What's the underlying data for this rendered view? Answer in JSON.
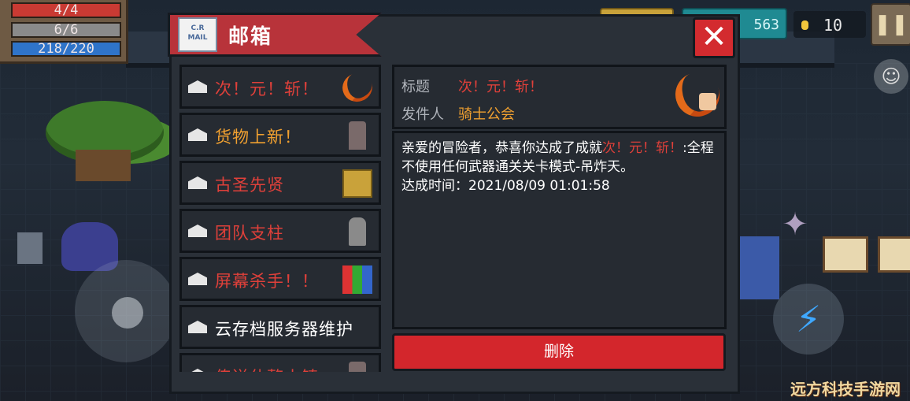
{
  "hud": {
    "hp": "4/4",
    "armor": "6/6",
    "energy": "218/220",
    "gems": "563",
    "coins": "10",
    "pause_icon": "pause-icon",
    "emote_icon": "smiley-icon",
    "skill_icon": "lightning-icon"
  },
  "mailbox": {
    "title": "邮箱",
    "close_label": "✕",
    "items": [
      {
        "label": "次！元！斩！",
        "color": "#e0403a",
        "icon": "crescent-blade-icon"
      },
      {
        "label": "货物上新！",
        "color": "#f0a030",
        "icon": "merchant-icon"
      },
      {
        "label": "古圣先贤",
        "color": "#e0403a",
        "icon": "golden-box-icon"
      },
      {
        "label": "团队支柱",
        "color": "#e0403a",
        "icon": "hooded-figure-icon"
      },
      {
        "label": "屏幕杀手！！",
        "color": "#e0403a",
        "icon": "colorful-blocks-icon"
      },
      {
        "label": "云存档服务器维护",
        "color": "#ffffff",
        "icon": ""
      },
      {
        "label": "传送休整小镇",
        "color": "#e0403a",
        "icon": "merchant-icon"
      }
    ],
    "detail": {
      "title_label": "标题",
      "title_value": "次！元！斩！",
      "sender_label": "发件人",
      "sender_value": "骑士公会",
      "message_prefix": "亲爱的冒险者，恭喜你达成了成就",
      "message_highlight": "次！元！斩！",
      "message_suffix": ":全程不使用任何武器通关关卡模式-吊炸天。",
      "achieved_time": "达成时间：2021/08/09 01:01:58"
    },
    "delete_label": "删除"
  },
  "watermark": "远方科技手游网",
  "colors": {
    "header_red": "#b8333a",
    "accent_red": "#e0403a",
    "accent_orange": "#f0a030",
    "panel_bg": "#2a3038"
  }
}
